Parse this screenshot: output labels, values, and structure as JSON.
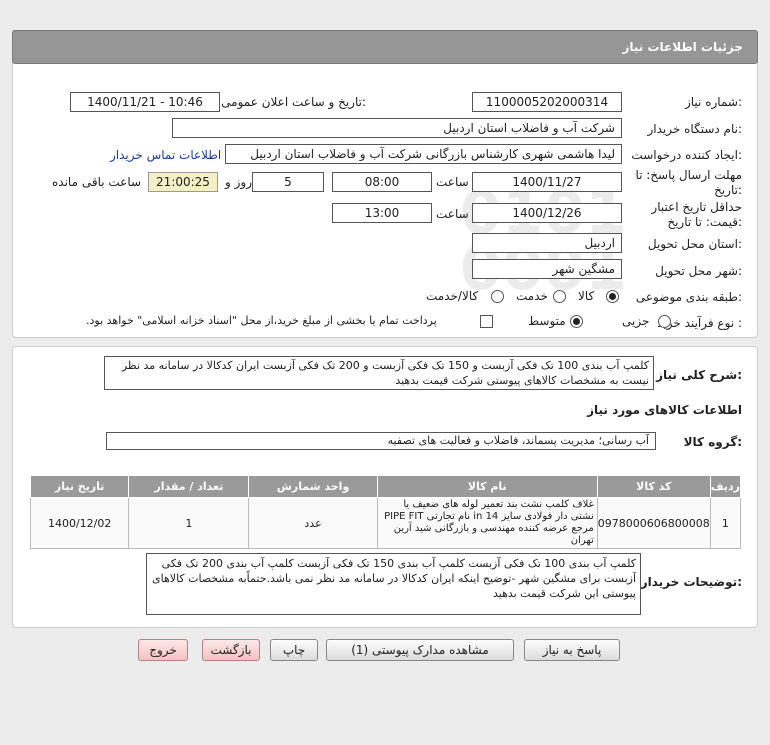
{
  "header": {
    "title": "جزئیات اطلاعات نیاز"
  },
  "form": {
    "need_number_label": "شماره نیاز:",
    "need_number": "1100005202000314",
    "announce_label": "تاریخ و ساعت اعلان عمومی:",
    "announce_value": "1400/11/21 - 10:46",
    "buyer_org_label": "نام دستگاه خریدار:",
    "buyer_org": "شرکت آب و فاضلاب استان اردبیل",
    "requester_label": "ایجاد کننده درخواست:",
    "requester": "لیدا  هاشمی شهری کارشناس بازرگانی شرکت آب و فاضلاب استان اردبیل",
    "contact_link": "اطلاعات تماس خریدار",
    "deadline_label_1": "مهلت ارسال پاسخ: تا",
    "deadline_label_2": "تاریخ:",
    "deadline_date": "1400/11/27",
    "time_label": "ساعت",
    "deadline_time": "08:00",
    "days_value": "5",
    "days_label": "روز و",
    "remaining_time": "21:00:25",
    "remaining_label": "ساعت باقی مانده",
    "validity_label_1": "حداقل تاریخ اعتبار",
    "validity_label_2": "قیمت: تا تاریخ:",
    "validity_date": "1400/12/26",
    "validity_time": "13:00",
    "delivery_place_label": "استان محل تحویل:",
    "delivery_place": "اردبیل",
    "delivery_city_label": "شهر محل تحویل:",
    "delivery_city": "مشگین شهر",
    "category_label": "طبقه بندی موضوعی:",
    "category_options": [
      "کالا",
      "خدمت",
      "کالا/خدمت"
    ],
    "process_label": "نوع فرآیند خرید :",
    "process_options": [
      "جزیی",
      "متوسط"
    ],
    "payment_note": "پرداخت تمام یا بخشی از مبلغ خرید،از محل \"اسناد خزانه اسلامی\" خواهد بود."
  },
  "details": {
    "summary_label": "شرح کلی نیاز:",
    "summary": "کلمپ آب بندی 100 تک فکی آزبست و 150 تک فکی آزبست و 200 تک فکی آزبست  ایران کدکالا در سامانه مد نظر نیست به مشخصات کالاهای پیوستی  شرکت قیمت بدهید",
    "goods_info_title": "اطلاعات کالاهای مورد نیاز",
    "group_label": "گروه کالا:",
    "group_value": "آب رسانی؛ مدیریت پسماند، فاضلاب و فعالیت های تصفیه",
    "table": {
      "headers": [
        "ردیف",
        "کد کالا",
        "نام کالا",
        "واحد شمارش",
        "تعداد / مقدار",
        "تاریخ نیاز"
      ],
      "rows": [
        {
          "row": "1",
          "code": "0978000606800008",
          "name": "غلاف کلمپ نشت بند تعمیر لوله های ضعیف یا نشتی دار فولادی سایز 14 in نام تجارتی PIPE FIT مرجع عرضه کننده مهندسی و بازرگانی شید آرین تهران",
          "unit": "عدد",
          "qty": "1",
          "date": "1400/12/02"
        }
      ]
    },
    "buyer_notes_label": "توضیحات خریدار:",
    "buyer_notes": "کلمپ آب بندی 100 تک فکی آزبست کلمپ آب بندی 150 تک فکی آزبست  کلمپ آب بندی 200 تک فکی آزبست  برای مشگین شهر -توضیح اینکه ایران کدکالا در سامانه مد نظر نمی باشد.حتماًبه مشخصات کالاهای پیوستی این شرکت قیمت بدهید"
  },
  "buttons": {
    "reply": "پاسخ به نیاز",
    "attachments": "مشاهده مدارک پیوستی (1)",
    "print": "چاپ",
    "back": "بازگشت",
    "exit": "خروج"
  },
  "colors": {
    "title_bar": "#969696",
    "link": "#1a3a9a",
    "exit_button": "#f3c2c2"
  }
}
